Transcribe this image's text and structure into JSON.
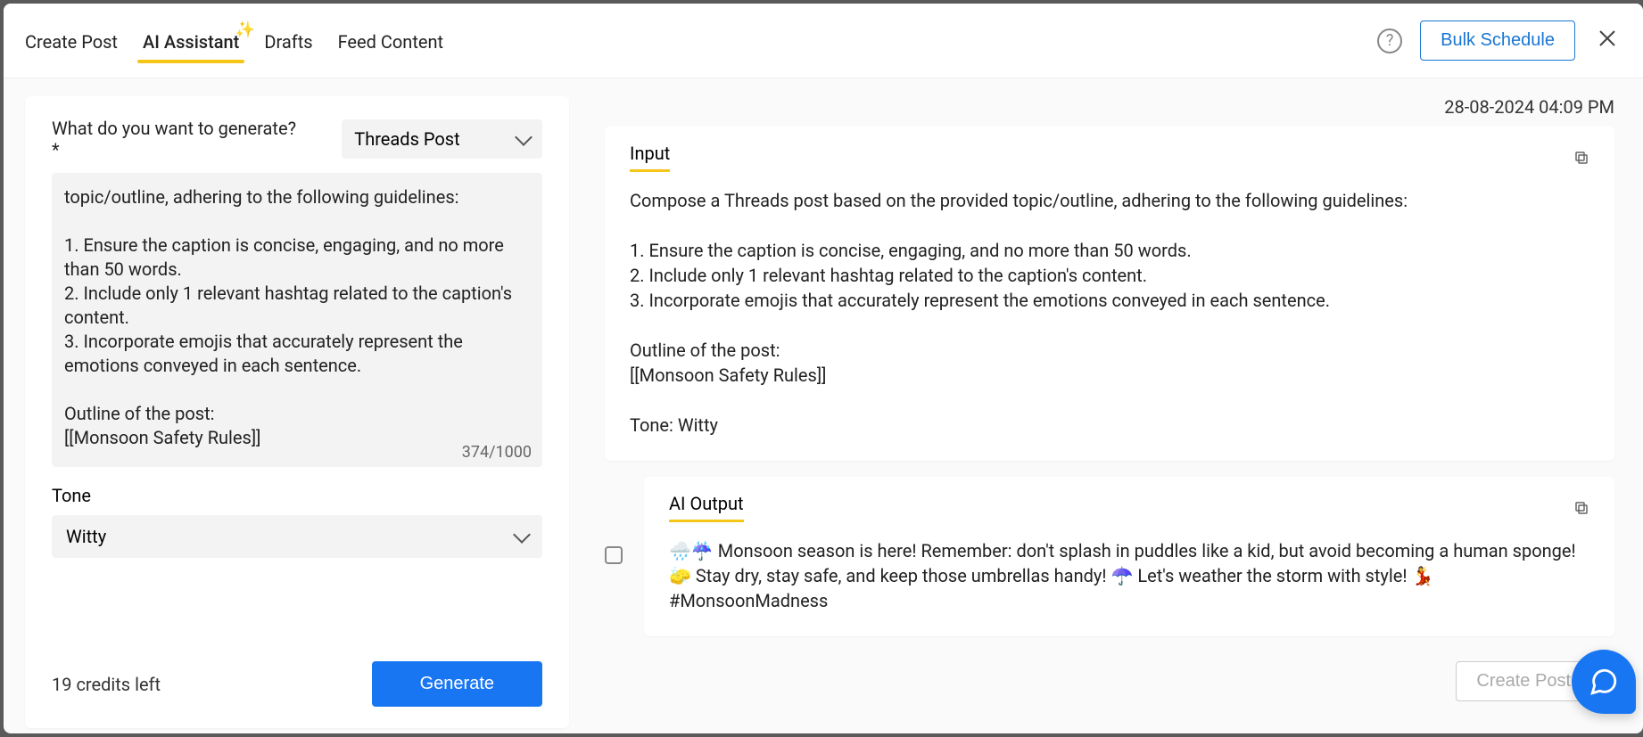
{
  "header": {
    "tabs": [
      "Create Post",
      "AI Assistant",
      "Drafts",
      "Feed Content"
    ],
    "bulk_schedule": "Bulk Schedule"
  },
  "left": {
    "what_label": "What do you want to generate?*",
    "type_selected": "Threads Post",
    "prompt_text": "topic/outline, adhering to the following guidelines:\n\n1. Ensure the caption is concise, engaging, and no more than 50 words.\n2. Include only 1 relevant hashtag related to the caption's content.\n3. Incorporate emojis that accurately represent the emotions conveyed in each sentence.\n\nOutline of the post:\n[[Monsoon Safety Rules]]",
    "counter": "374/1000",
    "tone_label": "Tone",
    "tone_selected": "Witty",
    "credits": "19 credits left",
    "generate": "Generate"
  },
  "right": {
    "timestamp": "28-08-2024 04:09 PM",
    "input_title": "Input",
    "input_body": "Compose a Threads post based on the provided topic/outline, adhering to the following guidelines:\n\n1. Ensure the caption is concise, engaging, and no more than 50 words.\n2. Include only 1 relevant hashtag related to the caption's content.\n3. Incorporate emojis that accurately represent the emotions conveyed in each sentence.\n\nOutline of the post:\n[[Monsoon Safety Rules]]\n\nTone: Witty",
    "output_title": "AI Output",
    "output_body": "🌧️☔ Monsoon season is here! Remember: don't splash in puddles like a kid, but avoid becoming a human sponge! 🧽 Stay dry, stay safe, and keep those umbrellas handy! ☂️ Let's weather the storm with style! 💃 #MonsoonMadness",
    "create_post": "Create Post"
  }
}
